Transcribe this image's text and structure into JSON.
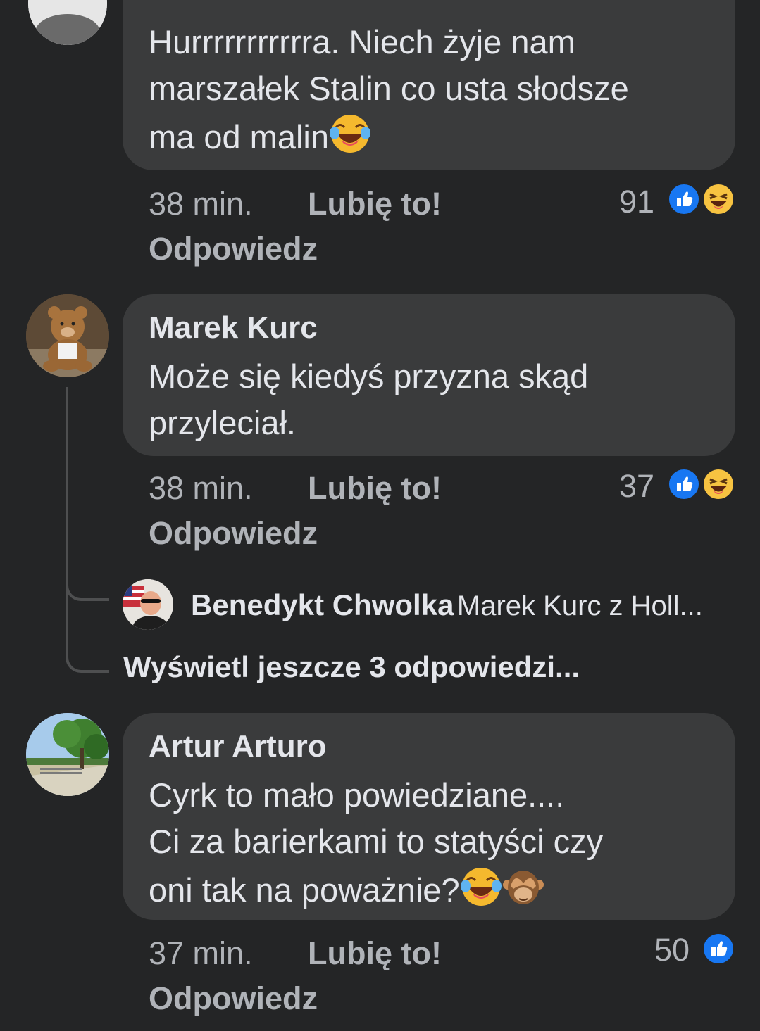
{
  "colors": {
    "background": "#242526",
    "bubble": "#3a3b3c",
    "text_primary": "#e4e6eb",
    "text_secondary": "#b0b3b8",
    "like_blue": "#1877f2",
    "haha_yellow": "#f7c341"
  },
  "comments": [
    {
      "author": "",
      "lines": [
        "Hurrrrrrrrrrra. Niech żyje nam",
        "marszałek Stalin co usta słodsze",
        "ma od malin"
      ],
      "time": "38 min.",
      "like_label": "Lubię to!",
      "reply_label": "Odpowiedz",
      "reaction_count": "91",
      "reactions": [
        "like-icon",
        "haha-icon"
      ]
    },
    {
      "author": "Marek Kurc",
      "lines": [
        "Może się kiedyś przyzna skąd",
        "przyleciał."
      ],
      "time": "38 min.",
      "like_label": "Lubię to!",
      "reply_label": "Odpowiedz",
      "reaction_count": "37",
      "reactions": [
        "like-icon",
        "haha-icon"
      ]
    },
    {
      "author": "Artur Arturo",
      "lines": [
        "Cyrk to mało powiedziane....",
        "Ci za barierkami to statyści czy",
        "oni tak na poważnie?"
      ],
      "time": "37 min.",
      "like_label": "Lubię to!",
      "reply_label": "Odpowiedz",
      "reaction_count": "50",
      "reactions": [
        "like-icon"
      ]
    }
  ],
  "reply_preview": {
    "author": "Benedykt Chwolka",
    "snippet": "Marek Kurc z Holl..."
  },
  "view_more_replies": "Wyświetl jeszcze 3 odpowiedzi..."
}
